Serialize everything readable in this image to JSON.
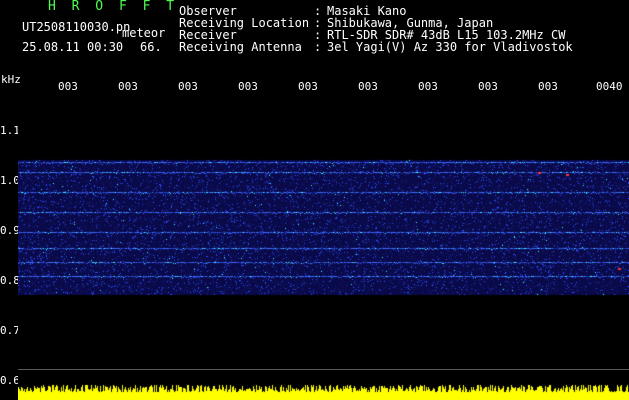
{
  "header": {
    "title": "H R O F F T",
    "filename": "UT2508110030.pn",
    "meteor_label": "meteor",
    "datetime": "25.08.11 00:30",
    "count": "66.",
    "info": [
      {
        "label": "Observer",
        "value": "Masaki Kano"
      },
      {
        "label": "Receiving Location",
        "value": "Shibukawa, Gunma, Japan"
      },
      {
        "label": "Receiver",
        "value": "RTL-SDR SDR# 43dB L15 103.2MHz CW"
      },
      {
        "label": "Receiving Antenna",
        "value": "3el Yagi(V) Az 330 for Vladivostok"
      }
    ]
  },
  "axis": {
    "unit": "kHz",
    "freq_ticks": [
      "1.1",
      "1.0",
      "0.9",
      "0.8",
      "0.7",
      "0.6"
    ],
    "time_ticks": [
      "003",
      "003",
      "003",
      "003",
      "003",
      "003",
      "003",
      "003",
      "003",
      "0040"
    ]
  },
  "colors": {
    "background": "#000000",
    "band": "#0a0a4a",
    "noise_blue": "#2a4aff",
    "noise_cyan": "#33ffff",
    "hot": "#ff3333",
    "meter": "#ffff00",
    "title_green": "#4dff4d"
  }
}
